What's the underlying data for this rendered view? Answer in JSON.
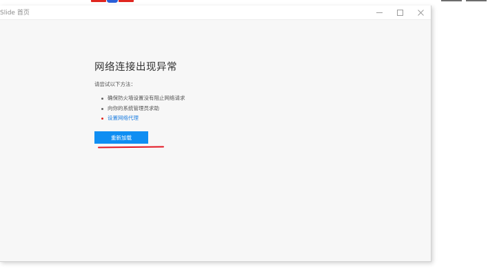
{
  "window": {
    "title": "Slide 首页"
  },
  "error": {
    "heading": "网络连接出现异常",
    "hint": "请尝试以下方法：",
    "tips": [
      "确保防火墙设置没有阻止网络请求",
      "向你的系统管理员求助"
    ],
    "proxy_link": "设置网络代理",
    "reload_label": "重新加载"
  },
  "colors": {
    "button": "#0f8ef2",
    "link": "#1f7fe0",
    "annotation": "#e3131f"
  },
  "icons": {
    "minimize": "minimize-icon",
    "maximize": "maximize-icon",
    "close": "close-icon"
  }
}
